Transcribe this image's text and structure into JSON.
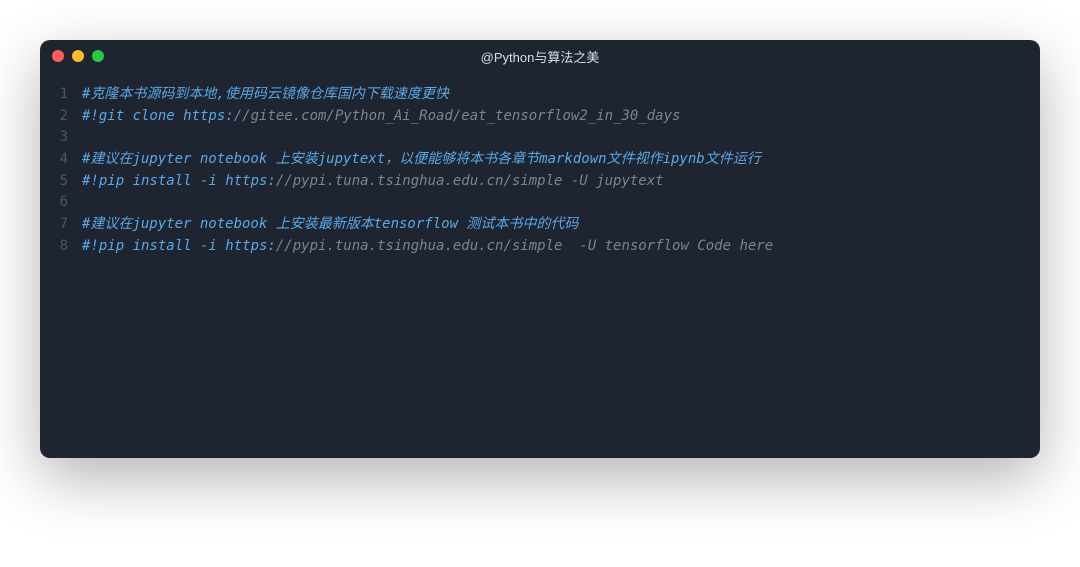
{
  "window": {
    "title": "@Python与算法之美"
  },
  "code": {
    "lines": [
      {
        "num": "1",
        "tokens": [
          {
            "cls": "tok-comment-blue",
            "text": "#克隆本书源码到本地,使用码云镜像仓库国内下载速度更快"
          }
        ]
      },
      {
        "num": "2",
        "tokens": [
          {
            "cls": "tok-comment-blue",
            "text": "#!git clone https:"
          },
          {
            "cls": "tok-url",
            "text": "//gitee.com/Python_Ai_Road/eat_tensorflow2_in_30_days"
          }
        ]
      },
      {
        "num": "3",
        "tokens": []
      },
      {
        "num": "4",
        "tokens": [
          {
            "cls": "tok-comment-blue",
            "text": "#建议在jupyter notebook 上安装jupytext，以便能够将本书各章节markdown文件视作ipynb文件运行"
          }
        ]
      },
      {
        "num": "5",
        "tokens": [
          {
            "cls": "tok-comment-blue",
            "text": "#!pip install -i https:"
          },
          {
            "cls": "tok-url",
            "text": "//pypi.tuna.tsinghua.edu.cn/simple -U jupytext"
          }
        ]
      },
      {
        "num": "6",
        "tokens": []
      },
      {
        "num": "7",
        "tokens": [
          {
            "cls": "tok-comment-blue",
            "text": "#建议在jupyter notebook 上安装最新版本tensorflow 测试本书中的代码"
          }
        ]
      },
      {
        "num": "8",
        "tokens": [
          {
            "cls": "tok-comment-blue",
            "text": "#!pip install -i https:"
          },
          {
            "cls": "tok-url",
            "text": "//pypi.tuna.tsinghua.edu.cn/simple  -U tensorflow Code here"
          }
        ]
      }
    ]
  }
}
